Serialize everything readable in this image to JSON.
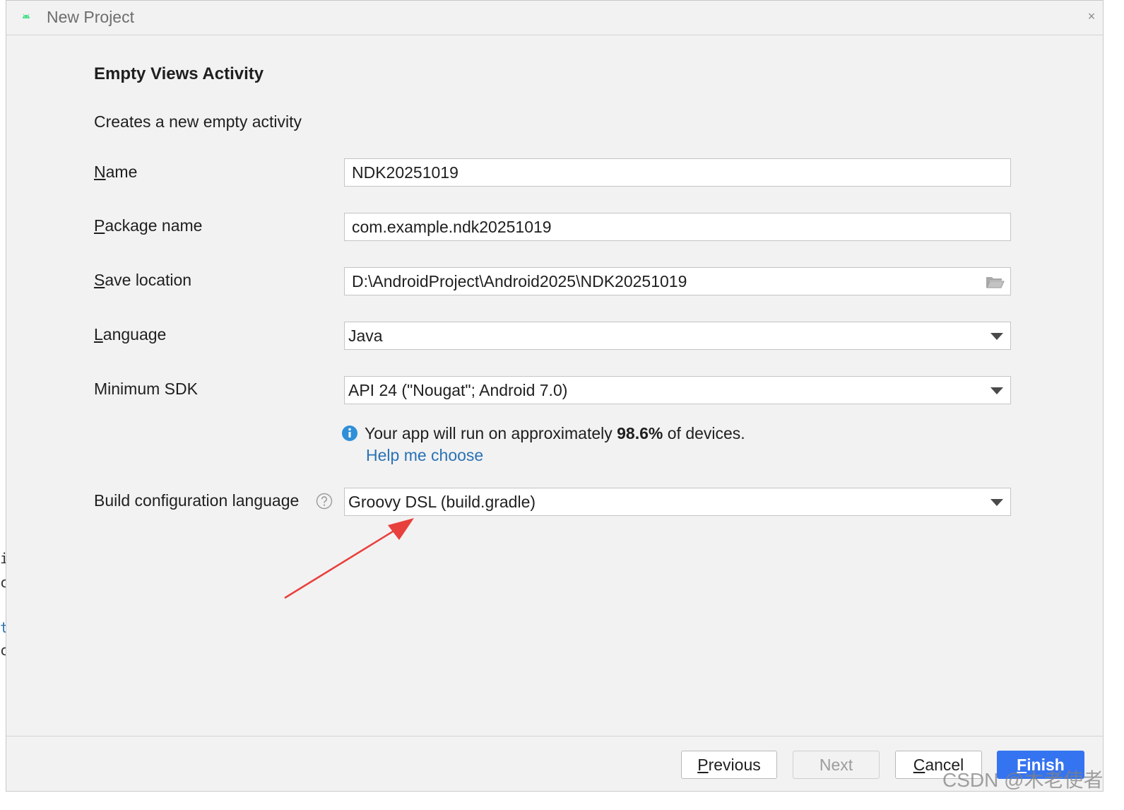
{
  "window": {
    "title": "New Project",
    "close_glyph": "×",
    "app_icon": "android-icon"
  },
  "template": {
    "heading": "Empty Views Activity",
    "description": "Creates a new empty activity"
  },
  "form": {
    "name": {
      "label_mnemonic": "N",
      "label_rest": "ame",
      "value": "NDK20251019"
    },
    "package_name": {
      "label_mnemonic": "P",
      "label_rest": "ackage name",
      "value": "com.example.ndk20251019"
    },
    "save_location": {
      "label_mnemonic": "S",
      "label_rest": "ave location",
      "value": "D:\\AndroidProject\\Android2025\\NDK20251019",
      "browse_icon": "folder-icon"
    },
    "language": {
      "label_mnemonic": "L",
      "label_rest": "anguage",
      "value": "Java"
    },
    "minimum_sdk": {
      "label": "Minimum SDK",
      "value": "API 24 (\"Nougat\"; Android 7.0)"
    },
    "sdk_info": {
      "prefix": "Your app will run on approximately ",
      "percent": "98.6%",
      "suffix": " of devices.",
      "help_link": "Help me choose",
      "icon": "info-icon"
    },
    "build_config_language": {
      "label": "Build configuration language",
      "value": "Groovy DSL (build.gradle)",
      "help_icon": "question-icon"
    }
  },
  "buttons": {
    "previous": {
      "mnemonic": "P",
      "rest": "revious"
    },
    "next": {
      "label": "Next",
      "enabled": false
    },
    "cancel": {
      "mnemonic": "C",
      "rest": "ancel"
    },
    "finish": {
      "mnemonic": "F",
      "rest": "inish"
    }
  },
  "edge_fragments": [
    "i",
    "c",
    "t",
    "c"
  ],
  "watermark": "CSDN @木老使者",
  "colors": {
    "accent": "#3574f0",
    "link": "#2a72b5",
    "info": "#2f8fd8",
    "annotation": "#e8403c",
    "dialog_bg": "#f2f2f2"
  }
}
